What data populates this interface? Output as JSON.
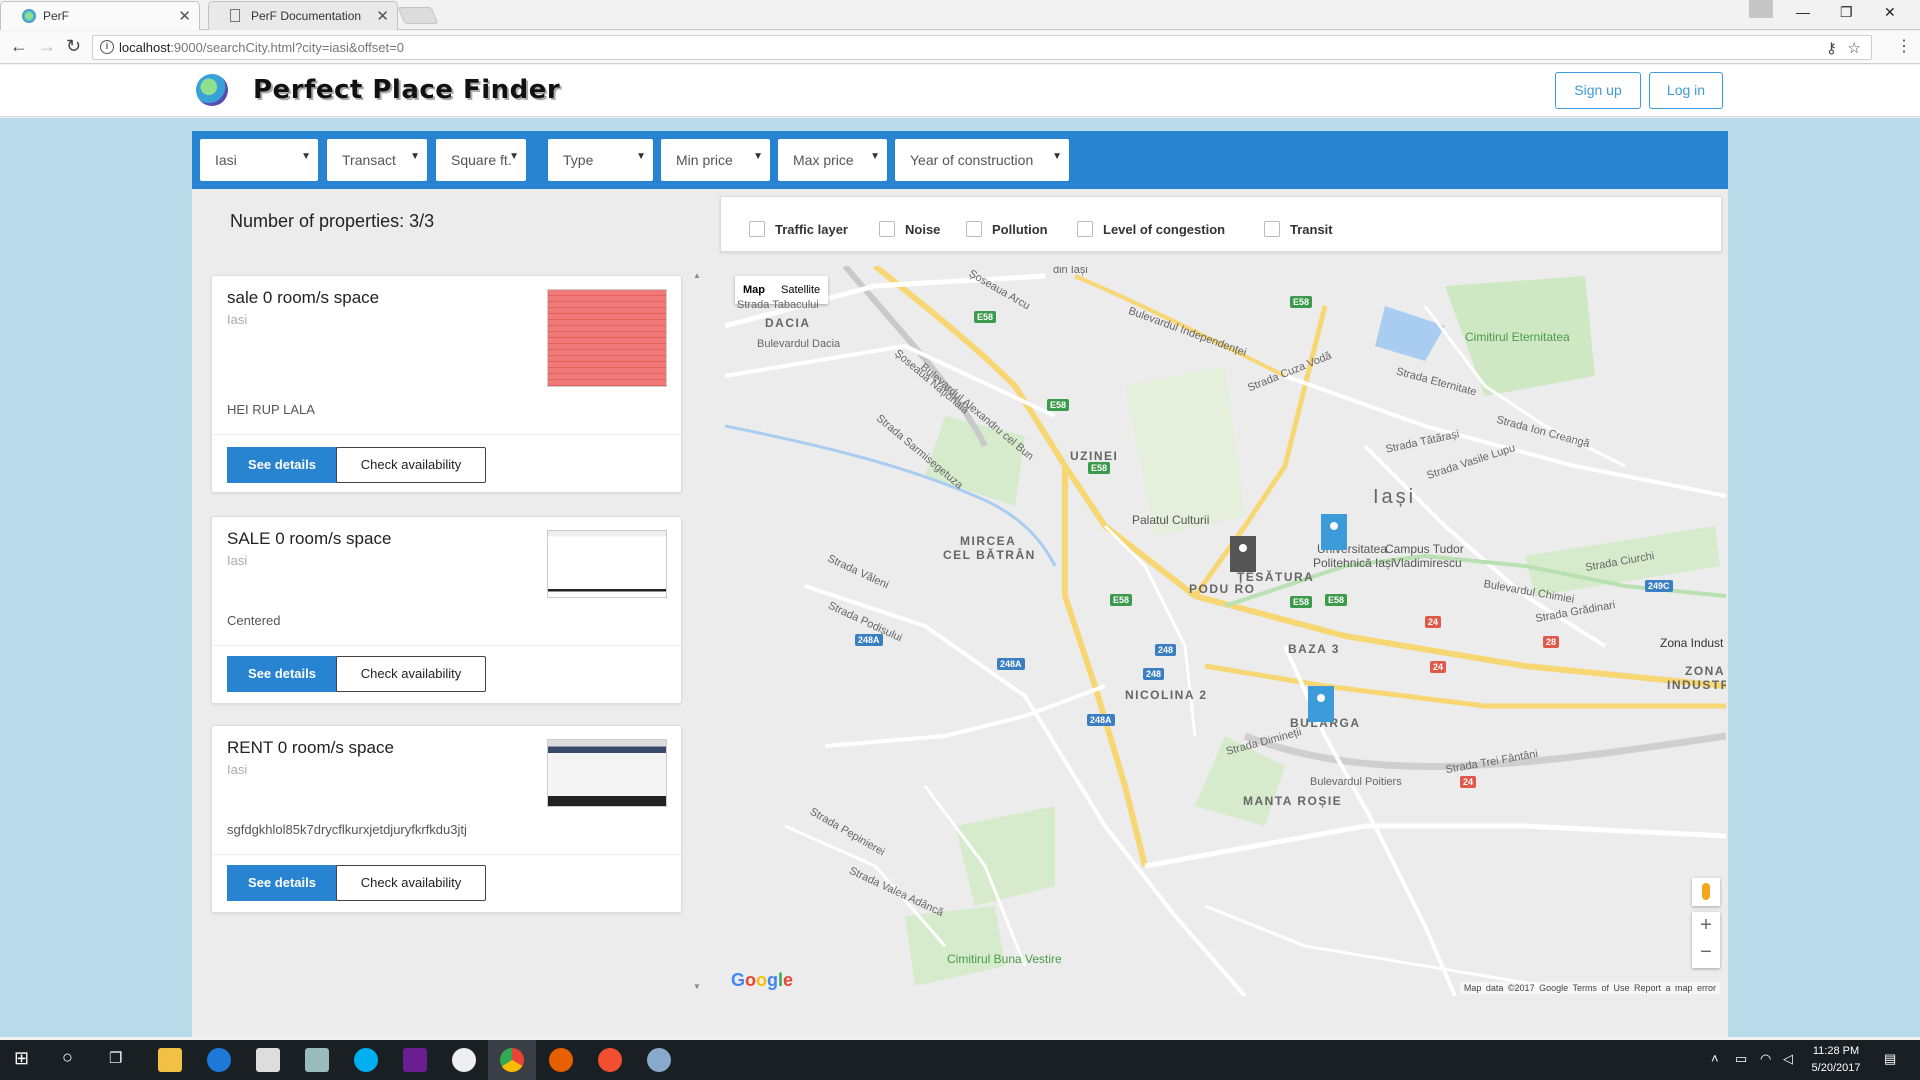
{
  "browser": {
    "tabs": [
      {
        "title": "PerF",
        "active": true
      },
      {
        "title": "PerF Documentation",
        "active": false
      }
    ],
    "url_host": "localhost",
    "url_rest": ":9000/searchCity.html?city=iasi&offset=0"
  },
  "site": {
    "title": "Perfect Place Finder",
    "signup_label": "Sign up",
    "login_label": "Log in"
  },
  "filters": [
    {
      "label": "Iasi"
    },
    {
      "label": "Transact"
    },
    {
      "label": "Square ft."
    },
    {
      "label": "Type"
    },
    {
      "label": "Min price"
    },
    {
      "label": "Max price"
    },
    {
      "label": "Year of construction"
    }
  ],
  "results": {
    "count_text": "Number of properties: 3/3"
  },
  "listings": [
    {
      "title": "sale 0 room/s space",
      "city": "Iasi",
      "description": "HEI RUP LALA",
      "details_label": "See details",
      "availability_label": "Check availability"
    },
    {
      "title": "SALE 0 room/s space",
      "city": "Iasi",
      "description": "Centered",
      "details_label": "See details",
      "availability_label": "Check availability"
    },
    {
      "title": "RENT 0 room/s space",
      "city": "Iasi",
      "description": "sgfdgkhlol85k7drycflkurxjetdjuryfkrfkdu3jtj",
      "details_label": "See details",
      "availability_label": "Check availability"
    }
  ],
  "layers": [
    {
      "label": "Traffic layer",
      "checked": false
    },
    {
      "label": "Noise",
      "checked": false
    },
    {
      "label": "Pollution",
      "checked": false
    },
    {
      "label": "Level of congestion",
      "checked": false
    },
    {
      "label": "Transit",
      "checked": false
    }
  ],
  "map": {
    "type_map_label": "Map",
    "type_satellite_label": "Satellite",
    "google_logo": "Google",
    "attribution": "Map data ©2017 Google",
    "terms_label": "Terms of Use",
    "report_label": "Report a map error",
    "labels": {
      "dacia": "DACIA",
      "uzinei": "UZINEI",
      "mircea1": "MIRCEA",
      "mircea2": "CEL BĂTRÂN",
      "iasi": "Iași",
      "podu_ros": "PODU RO",
      "tesatura": "ȚESĂTURA",
      "baza3": "BAZA 3",
      "nicolina": "NICOLINA 2",
      "bularga": "BULARGA",
      "manta": "MANTA ROȘIE",
      "zona_ind1": "ZONA",
      "zona_ind2": "INDUSTRIALĂ",
      "zona_indust": "Zona Indust",
      "palatul": "Palatul Culturii",
      "univ1": "Universitatea",
      "univ2": "Politehnică Iași",
      "campus1": "Campus Tudor",
      "campus2": "Vladimirescu",
      "cimitir_et": "Cimitirul Eternitatea",
      "cimitir_bv": "Cimitirul Buna Vestire",
      "din_iasi": "din Iași",
      "tabacului": "Strada Tabacului",
      "bd_dacia": "Bulevardul Dacia",
      "sos_arcu": "Șoseaua Arcu",
      "bd_indep": "Bulevardul Independenței",
      "str_cuza": "Strada Cuza Vodă",
      "sos_nat": "Șoseaua Națională",
      "bd_alex": "Bulevardul Alexandru cel Bun",
      "str_sarm": "Strada Sarmisegetuza",
      "str_vasile": "Strada Vasile Lupu",
      "str_tatarasi": "Strada Tătărași",
      "str_eternitate": "Strada Eternitate",
      "str_curchi": "Strada Ciurchi",
      "bd_chimiei": "Bulevardul Chimiei",
      "bd_poitiers": "Bulevardul Poitiers",
      "str_trei": "Strada Trei Fântâni",
      "str_valeni": "Strada Văleni",
      "str_podisului": "Strada Podișului",
      "str_pepinierei": "Strada Pepinierei",
      "str_valea": "Strada Valea Adâncă",
      "str_dimineții": "Strada Dimineții",
      "str_gradinari": "Strada Grădinari",
      "str_ion": "Strada Ion Creangă"
    },
    "shields": {
      "e58": "E58",
      "r248a": "248A",
      "r248": "248",
      "r249c": "249C",
      "r24": "24",
      "r28": "28"
    },
    "pins": [
      {
        "name": "pin-listing-1",
        "color": "#3d9bd9"
      },
      {
        "name": "pin-listing-2",
        "color": "#555555"
      },
      {
        "name": "pin-listing-3",
        "color": "#3d9bd9"
      }
    ]
  },
  "taskbar": {
    "time": "11:28 PM",
    "date": "5/20/2017"
  },
  "colors": {
    "accent": "#2884d1",
    "header_btn": "#3d9bd9",
    "page_bg": "#b9dbe9"
  }
}
